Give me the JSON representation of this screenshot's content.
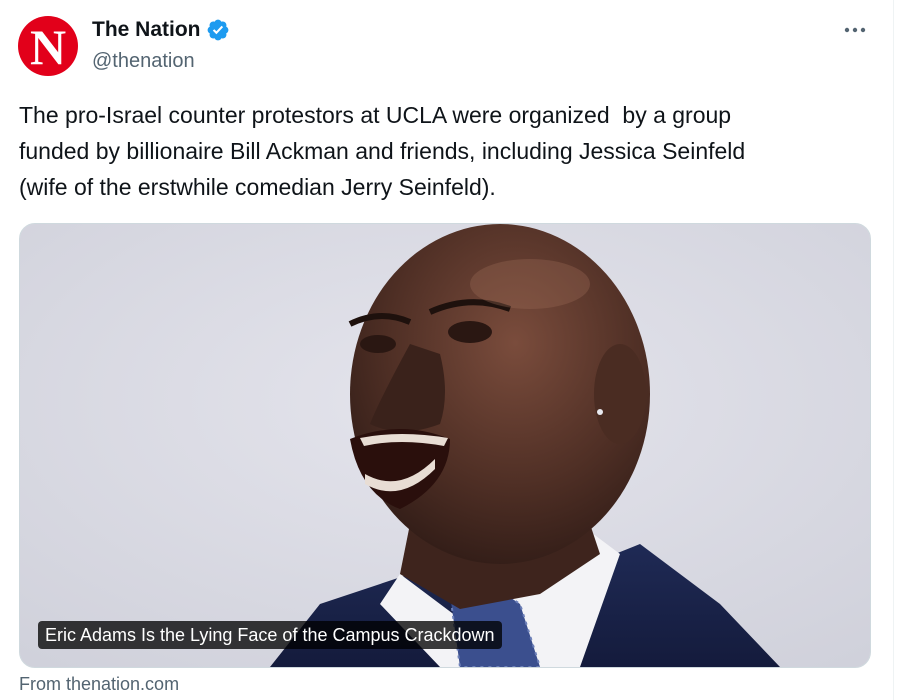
{
  "author": {
    "display_name": "The Nation",
    "handle": "@thenation",
    "avatar_letter": "N",
    "avatar_color": "#e2001a",
    "verified": true,
    "verified_color": "#1d9bf0"
  },
  "tweet": {
    "text": "The pro-Israel counter protestors at UCLA were organized  by a group\nfunded by billionaire Bill Ackman and friends, including Jessica Seinfeld\n(wife of the erstwhile comedian Jerry Seinfeld)."
  },
  "link_card": {
    "title": "Eric Adams Is the Lying Face of the Campus Crackdown",
    "source": "From thenation.com"
  },
  "icons": {
    "verified": "verified-badge-icon",
    "more": "more-options-icon"
  }
}
